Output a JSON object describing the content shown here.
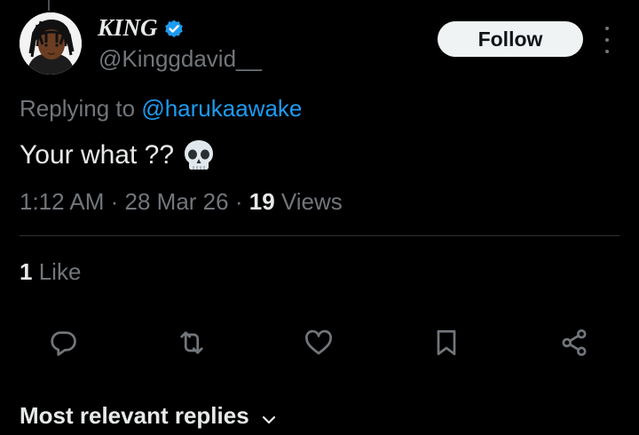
{
  "author": {
    "display_name": "KING",
    "handle": "@Kinggdavid__",
    "verified_icon": "verified-badge-icon",
    "verified_color": "#1d9bf0"
  },
  "follow_button": {
    "label": "Follow"
  },
  "more_menu": {
    "icon": "more-vertical-icon"
  },
  "reply_context": {
    "prefix": "Replying to",
    "mention": "@harukaawake",
    "mention_color": "#1d9bf0"
  },
  "tweet": {
    "text": "Your what ??",
    "emoji_icon": "skull-icon",
    "time": "1:12 AM",
    "date": "28 Mar 26",
    "views_count": "19",
    "views_label": "Views"
  },
  "engagement": {
    "likes_count": "1",
    "likes_label": "Like"
  },
  "actions": [
    {
      "name": "reply",
      "icon": "reply-icon"
    },
    {
      "name": "repost",
      "icon": "repost-icon"
    },
    {
      "name": "like",
      "icon": "heart-icon"
    },
    {
      "name": "bookmark",
      "icon": "bookmark-icon"
    },
    {
      "name": "share",
      "icon": "share-icon"
    }
  ],
  "replies": {
    "sort_label": "Most relevant replies",
    "icon": "chevron-down-icon"
  },
  "colors": {
    "background": "#000000",
    "text_primary": "#e7e9ea",
    "text_secondary": "#71767b",
    "accent": "#1d9bf0",
    "divider": "#2f3336"
  }
}
